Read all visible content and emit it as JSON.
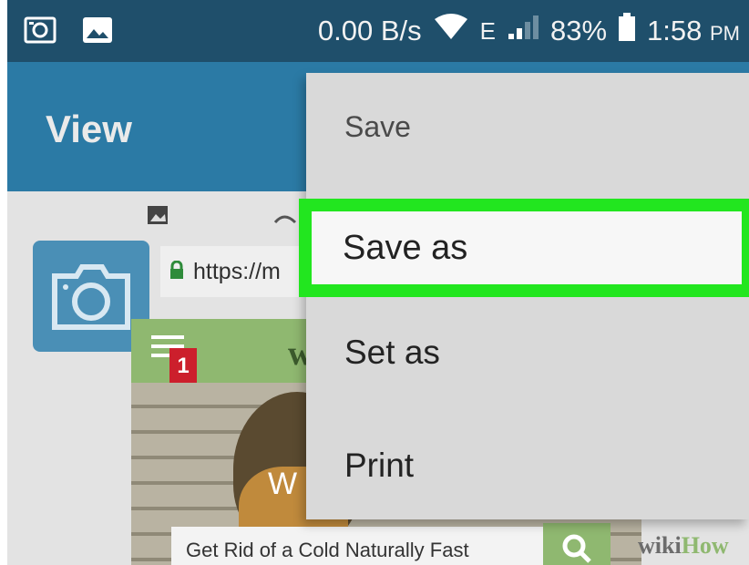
{
  "status_bar": {
    "speed": "0.00 B/s",
    "network": "E",
    "battery": "83%",
    "time": "1:58",
    "ampm": "PM"
  },
  "app_bar": {
    "title": "View"
  },
  "webpage": {
    "url": "https://m",
    "notification_count": "1",
    "logo_letter": "w",
    "illustration_text": "W",
    "search_text": "Get Rid of a Cold Naturally Fast",
    "brand": {
      "wiki": "wiki",
      "how": "How"
    }
  },
  "menu": {
    "items": [
      {
        "label": "Save"
      },
      {
        "label": "Save as",
        "highlighted": true
      },
      {
        "label": "Set as"
      },
      {
        "label": "Print"
      }
    ]
  },
  "colors": {
    "status_bar": "#1f4f6b",
    "app_bar": "#2b7aa5",
    "highlight": "#22e61f",
    "menu_bg": "#d9d9d9",
    "wikihow_green": "#8fb870"
  }
}
